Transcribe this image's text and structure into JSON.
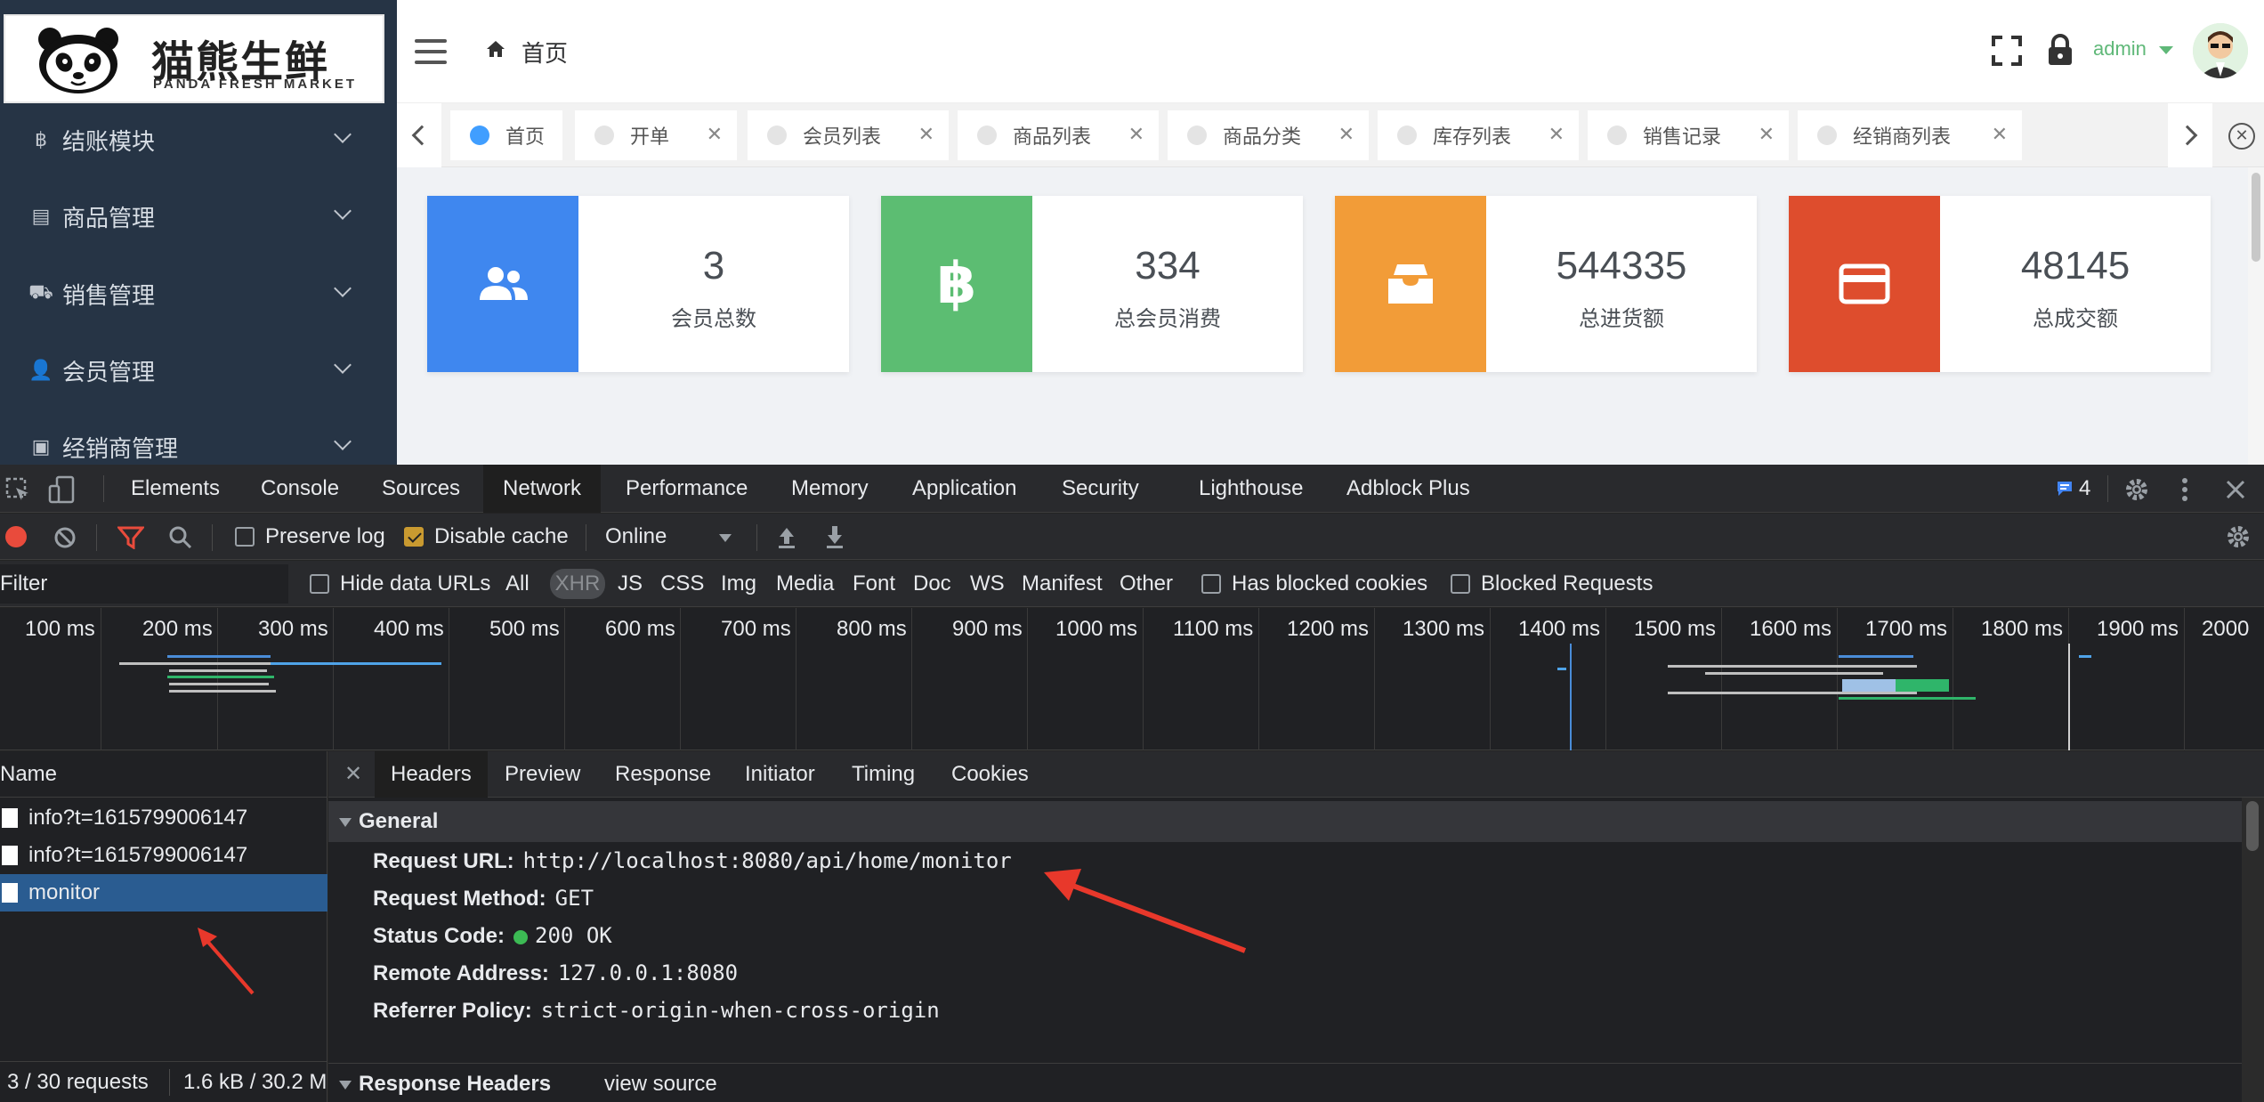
{
  "logo": {
    "title": "猫熊生鲜",
    "subtitle": "PANDA FRESH MARKET"
  },
  "sidebar": {
    "items": [
      {
        "label": "结账模块",
        "icon": "bitcoin-icon",
        "glyph": "฿"
      },
      {
        "label": "商品管理",
        "icon": "list-icon",
        "glyph": "▤"
      },
      {
        "label": "销售管理",
        "icon": "cart-icon",
        "glyph": "⛟"
      },
      {
        "label": "会员管理",
        "icon": "user-icon",
        "glyph": "👤"
      },
      {
        "label": "经销商管理",
        "icon": "money-icon",
        "glyph": "▣"
      }
    ]
  },
  "header": {
    "breadcrumb_home": "首页",
    "user": "admin"
  },
  "tabs": [
    {
      "label": "首页",
      "active": true,
      "closable": false
    },
    {
      "label": "开单",
      "active": false,
      "closable": true
    },
    {
      "label": "会员列表",
      "active": false,
      "closable": true
    },
    {
      "label": "商品列表",
      "active": false,
      "closable": true
    },
    {
      "label": "商品分类",
      "active": false,
      "closable": true
    },
    {
      "label": "库存列表",
      "active": false,
      "closable": true
    },
    {
      "label": "销售记录",
      "active": false,
      "closable": true
    },
    {
      "label": "经销商列表",
      "active": false,
      "closable": true
    }
  ],
  "stats": [
    {
      "value": "3",
      "label": "会员总数",
      "color": "#3f87ef",
      "icon": "people-icon"
    },
    {
      "value": "334",
      "label": "总会员消费",
      "color": "#5cbd72",
      "icon": "bitcoin-icon"
    },
    {
      "value": "544335",
      "label": "总进货额",
      "color": "#f29c38",
      "icon": "inbox-icon"
    },
    {
      "value": "48145",
      "label": "总成交额",
      "color": "#de4d2d",
      "icon": "credit-card-icon"
    }
  ],
  "devtools": {
    "tabs": [
      "Elements",
      "Console",
      "Sources",
      "Network",
      "Performance",
      "Memory",
      "Application",
      "Security",
      "Lighthouse",
      "Adblock Plus"
    ],
    "active_tab": "Network",
    "issues_count": "4",
    "toolbar": {
      "preserve_log": "Preserve log",
      "disable_cache": "Disable cache",
      "throttle": "Online"
    },
    "filter": {
      "placeholder": "Filter",
      "hide_data_urls": "Hide data URLs",
      "types": [
        "All",
        "XHR",
        "JS",
        "CSS",
        "Img",
        "Media",
        "Font",
        "Doc",
        "WS",
        "Manifest",
        "Other"
      ],
      "has_blocked_cookies": "Has blocked cookies",
      "blocked_requests": "Blocked Requests"
    },
    "timeline_ticks": [
      "100 ms",
      "200 ms",
      "300 ms",
      "400 ms",
      "500 ms",
      "600 ms",
      "700 ms",
      "800 ms",
      "900 ms",
      "1000 ms",
      "1100 ms",
      "1200 ms",
      "1300 ms",
      "1400 ms",
      "1500 ms",
      "1600 ms",
      "1700 ms",
      "1800 ms",
      "1900 ms",
      "2000"
    ],
    "name_header": "Name",
    "requests": [
      "info?t=1615799006147",
      "info?t=1615799006147",
      "monitor"
    ],
    "selected_request": "monitor",
    "summary_requests": "3 / 30 requests",
    "summary_size": "1.6 kB / 30.2 M",
    "detail_tabs": [
      "Headers",
      "Preview",
      "Response",
      "Initiator",
      "Timing",
      "Cookies"
    ],
    "general_title": "General",
    "general": [
      {
        "key": "Request URL:",
        "value": "http://localhost:8080/api/home/monitor"
      },
      {
        "key": "Request Method:",
        "value": "GET"
      },
      {
        "key": "Status Code:",
        "value": "200 OK"
      },
      {
        "key": "Remote Address:",
        "value": "127.0.0.1:8080"
      },
      {
        "key": "Referrer Policy:",
        "value": "strict-origin-when-cross-origin"
      }
    ],
    "response_headers_title": "Response Headers",
    "view_source": "view source"
  }
}
